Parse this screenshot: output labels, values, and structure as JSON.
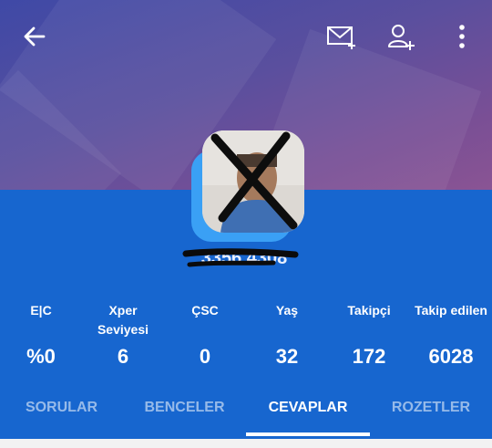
{
  "header": {
    "icons": {
      "back": "back-arrow-icon",
      "message": "mail-plus-icon",
      "follow": "add-user-icon",
      "more": "more-vertical-icon"
    },
    "colors": {
      "gradient_start": "#3f49a6",
      "gradient_end": "#8a5494"
    }
  },
  "profile": {
    "username": "3356 4308",
    "avatar": "user-photo-crossed-out"
  },
  "stats": [
    {
      "label": "E|C",
      "value": "%0"
    },
    {
      "label": "Xper Seviyesi",
      "value": "6"
    },
    {
      "label": "ÇSC",
      "value": "0"
    },
    {
      "label": "Yaş",
      "value": "32"
    },
    {
      "label": "Takipçi",
      "value": "172"
    },
    {
      "label": "Takip edilen",
      "value": "6028"
    }
  ],
  "tabs": [
    {
      "label": "SORULAR",
      "active": false
    },
    {
      "label": "BENCELER",
      "active": false
    },
    {
      "label": "CEVAPLAR",
      "active": true
    },
    {
      "label": "ROZETLER",
      "active": false
    }
  ],
  "colors": {
    "main_blue": "#1766cf",
    "accent_blue": "#3aa0f5"
  }
}
